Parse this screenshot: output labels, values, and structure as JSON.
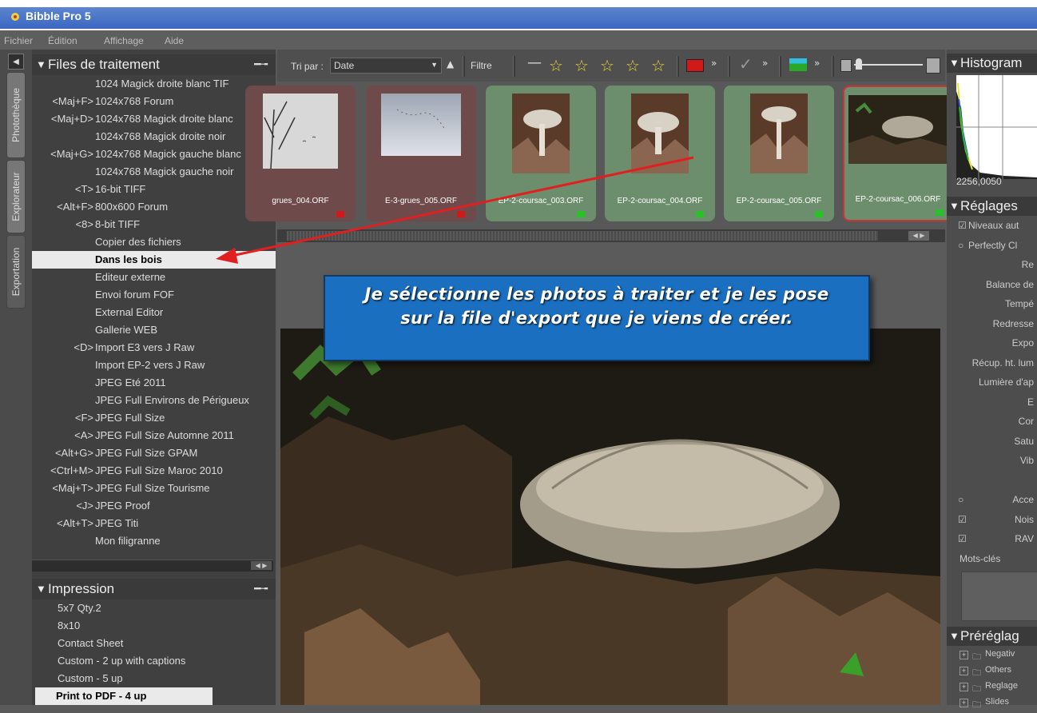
{
  "app": {
    "title": "Bibble Pro 5"
  },
  "menu": [
    "Fichier",
    "Édition",
    "Affichage",
    "Aide"
  ],
  "side_tabs": [
    "Photothèque",
    "Explorateur",
    "Exportation"
  ],
  "files_panel": {
    "title": "Files de traitement",
    "items": [
      {
        "shortcut": "",
        "name": "1024 Magick droite blanc TIF"
      },
      {
        "shortcut": "<Maj+F>",
        "name": "1024x768 Forum"
      },
      {
        "shortcut": "<Maj+D>",
        "name": "1024x768 Magick droite blanc"
      },
      {
        "shortcut": "",
        "name": "1024x768 Magick droite noir"
      },
      {
        "shortcut": "<Maj+G>",
        "name": "1024x768 Magick gauche blanc"
      },
      {
        "shortcut": "",
        "name": "1024x768 Magick gauche noir"
      },
      {
        "shortcut": "<T>",
        "name": "16-bit TIFF"
      },
      {
        "shortcut": "<Alt+F>",
        "name": "800x600 Forum"
      },
      {
        "shortcut": "<8>",
        "name": "8-bit TIFF"
      },
      {
        "shortcut": "",
        "name": "Copier des fichiers"
      },
      {
        "shortcut": "",
        "name": "Dans les bois",
        "selected": true
      },
      {
        "shortcut": "",
        "name": "Editeur externe"
      },
      {
        "shortcut": "",
        "name": "Envoi forum FOF"
      },
      {
        "shortcut": "",
        "name": "External Editor"
      },
      {
        "shortcut": "",
        "name": "Gallerie WEB"
      },
      {
        "shortcut": "<D>",
        "name": "Import E3 vers J Raw"
      },
      {
        "shortcut": "",
        "name": "Import EP-2 vers J Raw"
      },
      {
        "shortcut": "",
        "name": "JPEG Eté 2011"
      },
      {
        "shortcut": "",
        "name": "JPEG Full Environs de Périgueux"
      },
      {
        "shortcut": "<F>",
        "name": "JPEG Full Size"
      },
      {
        "shortcut": "<A>",
        "name": "JPEG Full Size Automne 2011"
      },
      {
        "shortcut": "<Alt+G>",
        "name": "JPEG Full Size GPAM"
      },
      {
        "shortcut": "<Ctrl+M>",
        "name": "JPEG Full Size Maroc 2010"
      },
      {
        "shortcut": "<Maj+T>",
        "name": "JPEG Full Size Tourisme"
      },
      {
        "shortcut": "<J>",
        "name": "JPEG Proof"
      },
      {
        "shortcut": "<Alt+T>",
        "name": "JPEG Titi"
      },
      {
        "shortcut": "",
        "name": "Mon filigranne"
      }
    ]
  },
  "print_panel": {
    "title": "Impression",
    "items": [
      {
        "name": "5x7 Qty.2"
      },
      {
        "name": "8x10"
      },
      {
        "name": "Contact Sheet"
      },
      {
        "name": "Custom - 2 up with captions"
      },
      {
        "name": "Custom - 5 up"
      },
      {
        "name": "Print to PDF - 4 up",
        "selected": true
      }
    ]
  },
  "toolbar": {
    "sort_label": "Tri par :",
    "sort_value": "Date",
    "filter_label": "Filtre"
  },
  "thumbnails": [
    {
      "file": "grues_004.ORF",
      "color": "red"
    },
    {
      "file": "E-3-grues_005.ORF",
      "color": "red"
    },
    {
      "file": "EP-2-coursac_003.ORF",
      "color": "green"
    },
    {
      "file": "EP-2-coursac_004.ORF",
      "color": "green"
    },
    {
      "file": "EP-2-coursac_005.ORF",
      "color": "green"
    },
    {
      "file": "EP-2-coursac_006.ORF",
      "color": "green",
      "selected": true
    }
  ],
  "callout": {
    "line1": "Je sélectionne les photos à traiter et je les pose",
    "line2": "sur la file d'export que je viens de créer."
  },
  "right_panel": {
    "histogram_title": "Histogram",
    "histogram_value": "2256,0050",
    "settings_title": "Réglages",
    "settings": [
      {
        "label": "Niveaux aut",
        "check": "☑"
      },
      {
        "label": "Perfectly Cl",
        "check": "○"
      },
      {
        "label": "Re"
      },
      {
        "label": "Balance de"
      },
      {
        "label": "Tempé"
      },
      {
        "label": "Redresse"
      },
      {
        "label": "Expo"
      },
      {
        "label": "Récup. ht. lum"
      },
      {
        "label": "Lumière d'ap"
      },
      {
        "label": "E"
      },
      {
        "label": "Cor"
      },
      {
        "label": "Satu"
      },
      {
        "label": "Vib"
      },
      {
        "label": ""
      },
      {
        "label": "Acce",
        "check": "○"
      },
      {
        "label": "Nois",
        "check": "☑"
      },
      {
        "label": "RAV",
        "check": "☑"
      },
      {
        "label": "Mots-clés"
      }
    ],
    "presets_title": "Préréglag",
    "presets": [
      "Negativ",
      "Others",
      "Reglage",
      "Slides"
    ]
  },
  "colors": {
    "accent_blue": "#1a6fc0",
    "arrow_red": "#e02020",
    "thumb_green": "#6d8e6d",
    "thumb_red": "#6e4a4a"
  }
}
